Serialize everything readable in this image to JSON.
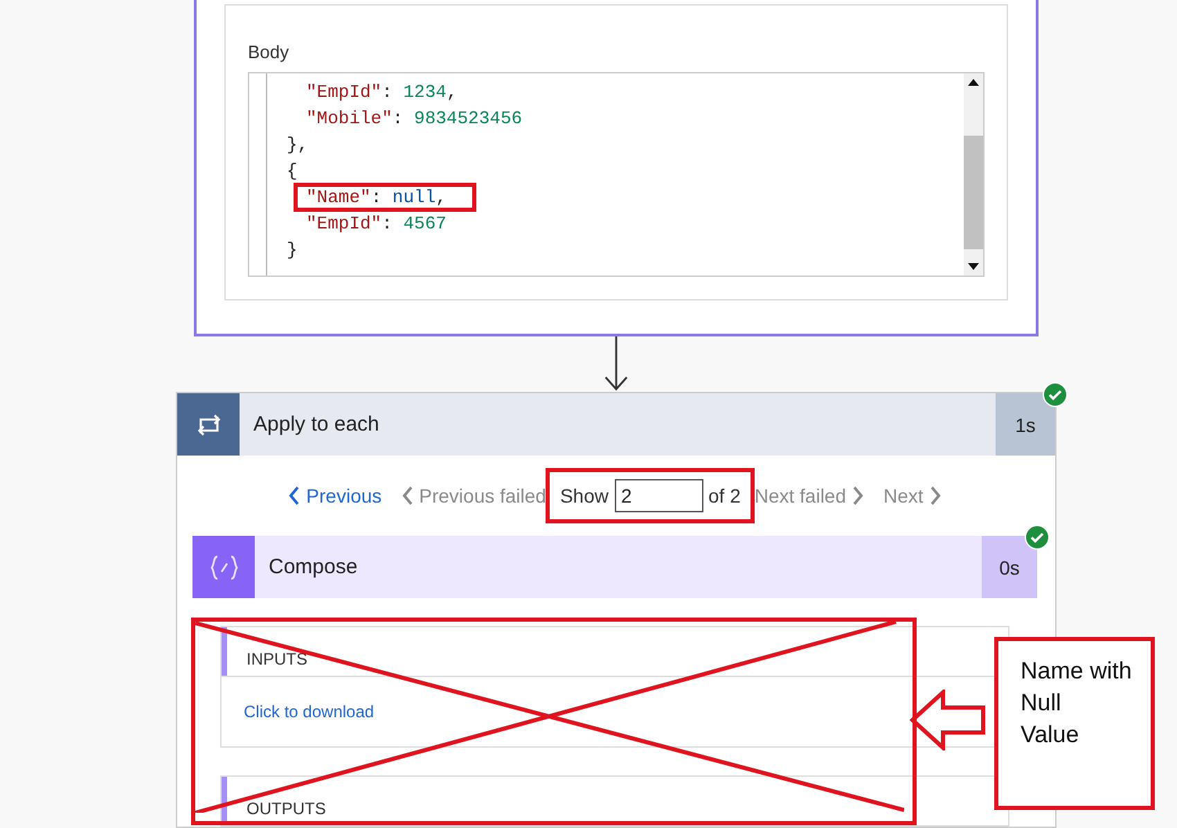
{
  "body_card": {
    "label": "Body",
    "code_lines": [
      {
        "children": [
          {
            "tokens": [
              {
                "kind": "key",
                "text": "\"EmpId\""
              },
              {
                "kind": "punct",
                "text": ": "
              },
              {
                "kind": "number",
                "text": "1234"
              },
              {
                "kind": "punct",
                "text": ","
              }
            ]
          },
          {
            "tokens": [
              {
                "kind": "key",
                "text": "\"Mobile\""
              },
              {
                "kind": "punct",
                "text": ": "
              },
              {
                "kind": "number",
                "text": "9834523456"
              }
            ]
          }
        ]
      },
      {
        "tokens": [
          {
            "kind": "punct",
            "text": "},"
          }
        ]
      },
      {
        "tokens": [
          {
            "kind": "punct",
            "text": "{"
          }
        ],
        "children": [
          {
            "highlighted": true,
            "tokens": [
              {
                "kind": "key",
                "text": "\"Name\""
              },
              {
                "kind": "punct",
                "text": ": "
              },
              {
                "kind": "null",
                "text": "null"
              },
              {
                "kind": "punct",
                "text": ","
              }
            ]
          },
          {
            "tokens": [
              {
                "kind": "key",
                "text": "\"EmpId\""
              },
              {
                "kind": "punct",
                "text": ": "
              },
              {
                "kind": "number",
                "text": "4567"
              }
            ]
          }
        ]
      },
      {
        "tokens": [
          {
            "kind": "punct",
            "text": "}"
          }
        ]
      }
    ]
  },
  "apply_to_each": {
    "title": "Apply to each",
    "duration": "1s",
    "succeeded": true,
    "pager": {
      "items": [
        {
          "label": "Previous",
          "kind": "prev",
          "disabled": false
        },
        {
          "label": "Previous failed",
          "kind": "prev",
          "disabled": true
        }
      ],
      "show_label": "Show",
      "show_value": "2",
      "of_label": "of 2",
      "highlighted": true,
      "items_after": [
        {
          "label": "Next failed",
          "kind": "next",
          "disabled": true
        },
        {
          "label": "Next",
          "kind": "next",
          "disabled": true
        }
      ]
    },
    "compose": {
      "title": "Compose",
      "duration": "0s",
      "succeeded": true,
      "sections": [
        {
          "heading": "INPUTS",
          "link": "Click to download"
        },
        {
          "heading": "OUTPUTS"
        }
      ],
      "crossed_out": true
    }
  },
  "annotation": {
    "note_lines": [
      "Name with",
      "Null",
      "Value"
    ]
  }
}
